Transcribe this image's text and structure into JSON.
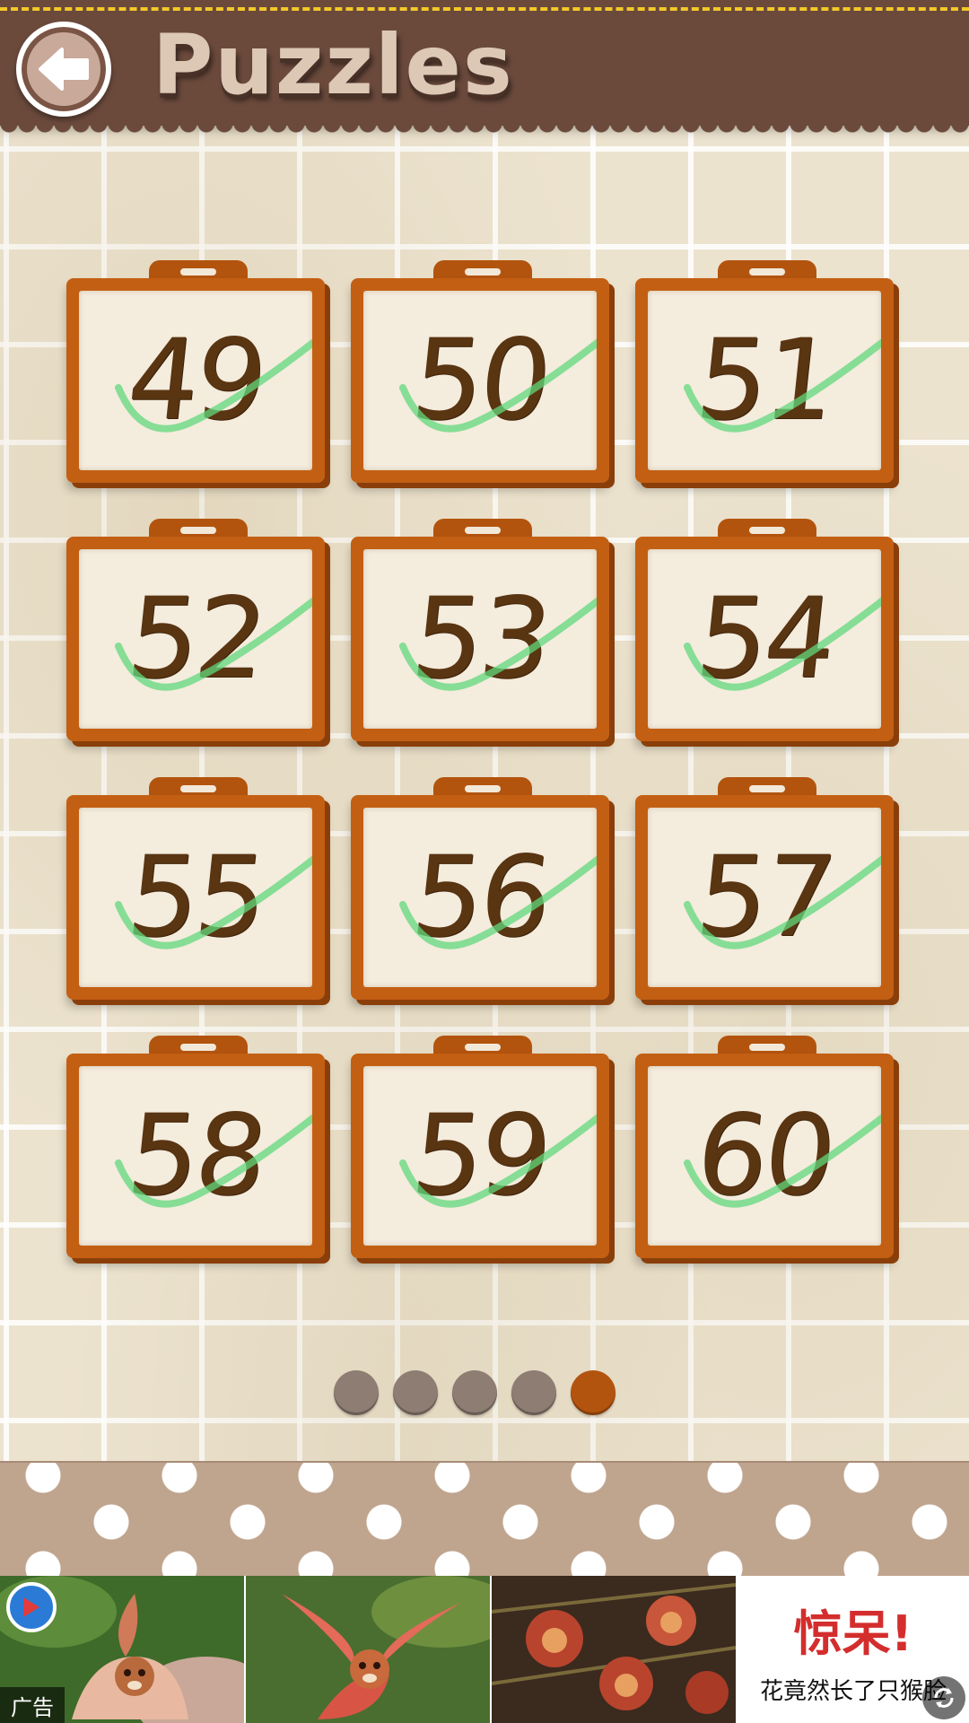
{
  "header": {
    "title": "Puzzles",
    "back_icon": "back-arrow-icon"
  },
  "puzzles": [
    {
      "number": "49",
      "completed": true
    },
    {
      "number": "50",
      "completed": true
    },
    {
      "number": "51",
      "completed": true
    },
    {
      "number": "52",
      "completed": true
    },
    {
      "number": "53",
      "completed": true
    },
    {
      "number": "54",
      "completed": true
    },
    {
      "number": "55",
      "completed": true
    },
    {
      "number": "56",
      "completed": true
    },
    {
      "number": "57",
      "completed": true
    },
    {
      "number": "58",
      "completed": true
    },
    {
      "number": "59",
      "completed": true
    },
    {
      "number": "60",
      "completed": true
    }
  ],
  "pagination": {
    "pages": 5,
    "current": 5
  },
  "ad": {
    "headline": "惊呆!",
    "subtext": "花竟然长了只猴脸",
    "label": "广告"
  },
  "colors": {
    "header": "#6b4a3c",
    "tile_frame": "#c35f13",
    "number_ink": "#5a3512",
    "check": "#62d87c",
    "dot_inactive": "#8e7d72",
    "dot_active": "#b3540e",
    "ad_headline": "#d42d2d"
  }
}
